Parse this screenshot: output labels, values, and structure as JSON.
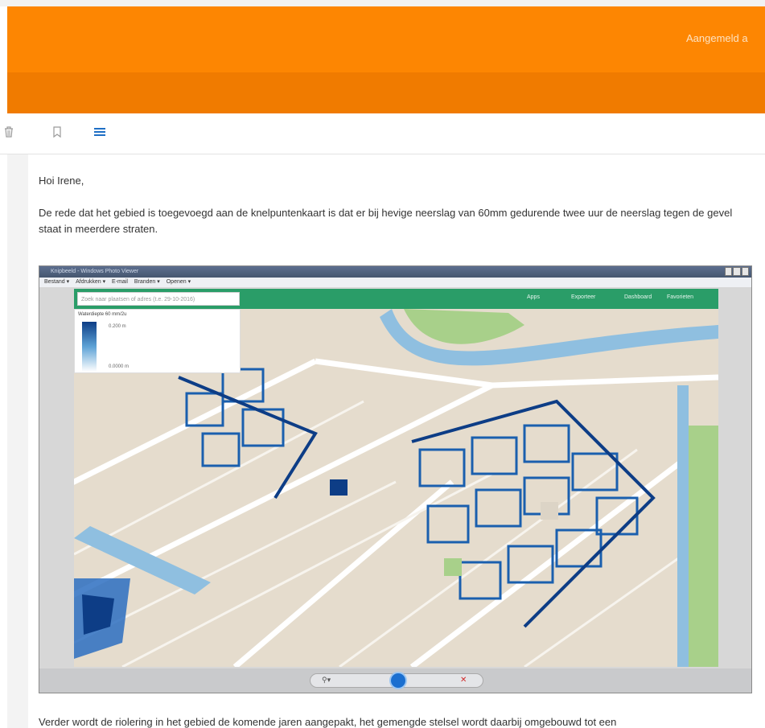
{
  "header": {
    "signed_in_text": "Aangemeld a"
  },
  "toolbar": {
    "icons": [
      "trash-icon",
      "bookmark-icon",
      "menu-icon"
    ]
  },
  "email": {
    "greeting": "Hoi Irene,",
    "paragraph1": "De rede dat het gebied is toegevoegd aan de knelpuntenkaart is dat er bij hevige neerslag van 60mm gedurende twee uur de neerslag tegen de gevel staat in meerdere straten.",
    "paragraph2": "Verder wordt de riolering in het gebied de komende jaren aangepakt, het gemengde stelsel wordt daarbij omgebouwd tot een"
  },
  "screenshot": {
    "window_title": "Knipbeeld - Windows Photo Viewer",
    "menu": [
      "Bestand ▾",
      "Afdrukken ▾",
      "E-mail",
      "Branden ▾",
      "Openen ▾"
    ],
    "map_bar": [
      "Apps",
      "Exporteer",
      "Dashboard",
      "Favorieten"
    ],
    "search_placeholder": "Zoek naar plaatsen of adres (t.e. 29-10-2016)",
    "legend": {
      "title": "Waterdiepte 60 mm/2u",
      "max": "0.200 m",
      "min": "0.0000 m"
    },
    "colors": {
      "map_bar": "#2a9d68",
      "map_base": "#e5dccd",
      "water_dark": "#0d3d86",
      "water_light": "#5ea3d6"
    }
  },
  "colors": {
    "header_top": "#fd8602",
    "header_bottom": "#f07b00",
    "menu_icon": "#1f6fc5"
  }
}
